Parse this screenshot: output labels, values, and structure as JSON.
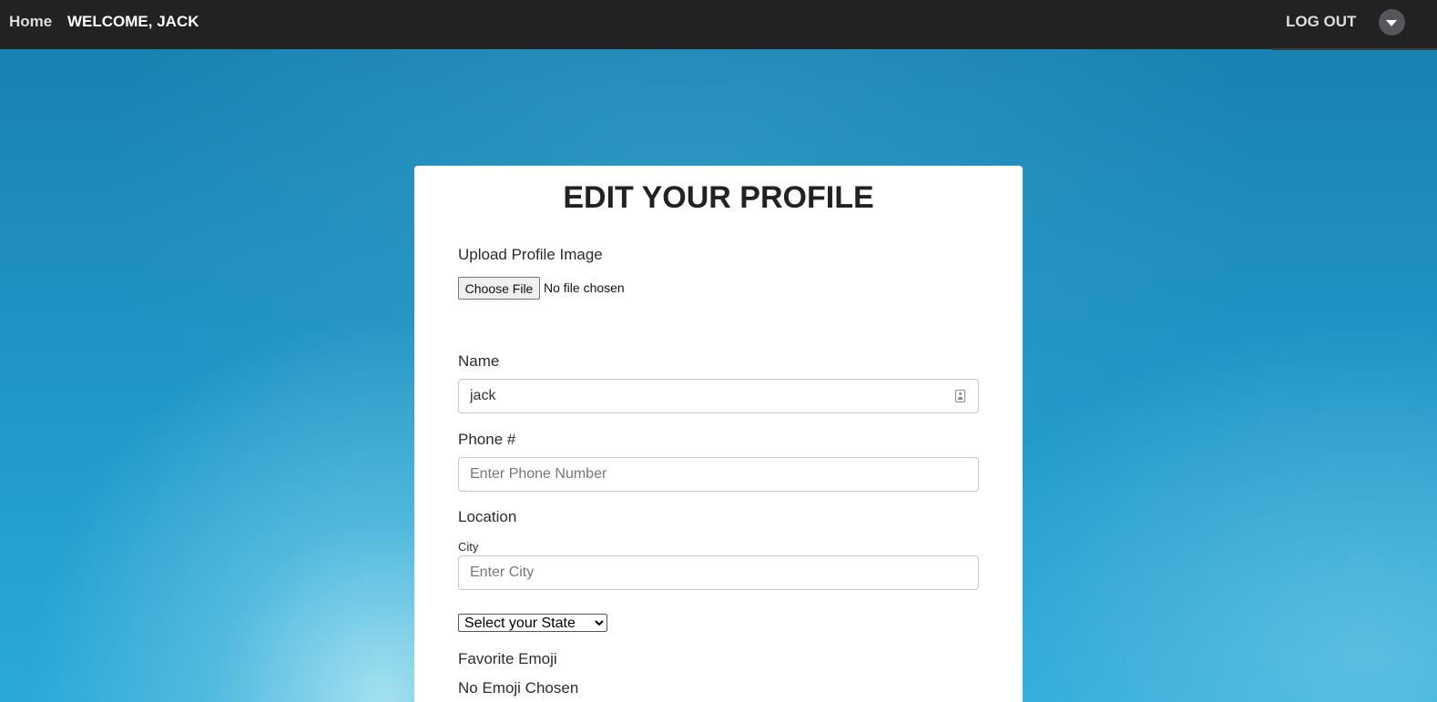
{
  "navbar": {
    "home": "Home",
    "welcome": "WELCOME, JACK",
    "logout": "LOG OUT",
    "dropdown_icon": "caret-down-icon"
  },
  "colors": {
    "navbar_bg": "#222222",
    "background_top": "#177fae",
    "background_bottom": "#2aa9d8",
    "card_bg": "#ffffff"
  },
  "form": {
    "title": "EDIT YOUR PROFILE",
    "upload": {
      "label": "Upload Profile Image",
      "button": "Choose File",
      "status": "No file chosen"
    },
    "name": {
      "label": "Name",
      "value": "jack",
      "icon": "contact-card-icon"
    },
    "phone": {
      "label": "Phone #",
      "placeholder": "Enter Phone Number"
    },
    "location": {
      "label": "Location",
      "city_label": "City",
      "city_placeholder": "Enter City",
      "state_selected": "Select your State"
    },
    "emoji": {
      "label": "Favorite Emoji",
      "status": "No Emoji Chosen"
    }
  }
}
